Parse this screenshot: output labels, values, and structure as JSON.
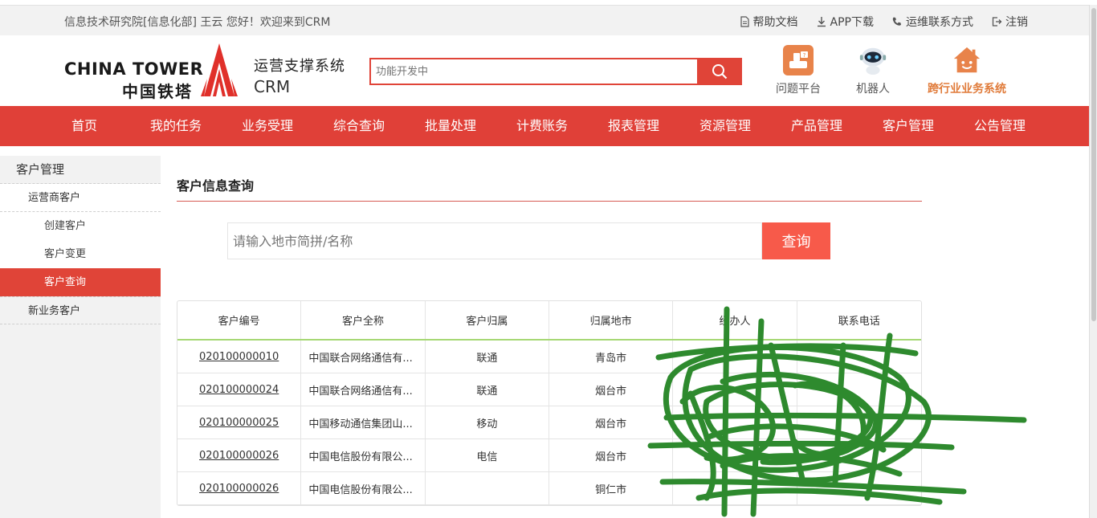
{
  "topbar": {
    "welcome": "信息技术研究院[信息化部] 王云 您好！欢迎来到CRM",
    "links": [
      "帮助文档",
      "APP下载",
      "运维联系方式",
      "注销"
    ]
  },
  "header": {
    "logo_en": "CHINA TOWER",
    "logo_cn": "中国铁塔",
    "system_name": "运营支撑系统",
    "system_sub": "CRM",
    "search_placeholder": "功能开发中",
    "quick_links": [
      "问题平台",
      "机器人",
      "跨行业业务系统"
    ]
  },
  "nav": [
    "首页",
    "我的任务",
    "业务受理",
    "综合查询",
    "批量处理",
    "计费账务",
    "报表管理",
    "资源管理",
    "产品管理",
    "客户管理",
    "公告管理"
  ],
  "sidebar": {
    "title": "客户管理",
    "group1": "运营商客户",
    "items": [
      "创建客户",
      "客户变更",
      "客户查询"
    ],
    "group2": "新业务客户"
  },
  "main": {
    "title": "客户信息查询",
    "search_placeholder": "请输入地市简拼/名称",
    "search_button": "查询"
  },
  "table": {
    "headers": [
      "客户编号",
      "客户全称",
      "客户归属",
      "归属地市",
      "经办人",
      "联系电话"
    ],
    "rows": [
      [
        "020100000010",
        "中国联合网络通信有...",
        "联通",
        "青岛市",
        "",
        ""
      ],
      [
        "020100000024",
        "中国联合网络通信有...",
        "联通",
        "烟台市",
        "",
        ""
      ],
      [
        "020100000025",
        "中国移动通信集团山...",
        "移动",
        "烟台市",
        "",
        ""
      ],
      [
        "020100000026",
        "中国电信股份有限公...",
        "电信",
        "烟台市",
        "",
        ""
      ],
      [
        "020100000026",
        "中国电信股份有限公...",
        "",
        "铜仁市",
        "",
        ""
      ]
    ]
  },
  "colors": {
    "brand_red": "#e04438",
    "nav_red": "#e04038",
    "query_button": "#f75a4a",
    "header_underline": "#a6d874",
    "scribble": "#2e8a2e"
  }
}
